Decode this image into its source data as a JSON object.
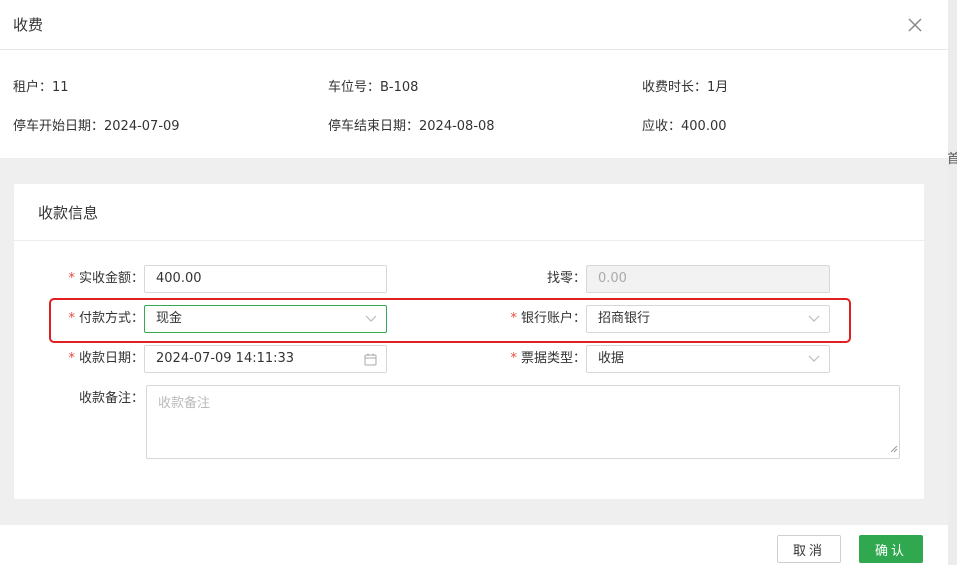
{
  "dialog": {
    "title": "收费",
    "close_icon": "close-icon"
  },
  "summary": {
    "tenant": "租户：11",
    "space": "车位号：B-108",
    "duration": "收费时长：1月",
    "start_date": "停车开始日期：2024-07-09",
    "end_date": "停车结束日期：2024-08-08",
    "receivable": "应收：400.00"
  },
  "payment_section": {
    "title": "收款信息",
    "amount": {
      "label": "实收金额：",
      "value": "400.00"
    },
    "change": {
      "label": "找零：",
      "placeholder": "0.00"
    },
    "method": {
      "label": "付款方式：",
      "value": "现金"
    },
    "bank_account": {
      "label": "银行账户：",
      "value": "招商银行"
    },
    "date": {
      "label": "收款日期：",
      "value": "2024-07-09 14:11:33"
    },
    "receipt_type": {
      "label": "票据类型：",
      "value": "收据"
    },
    "note": {
      "label": "收款备注：",
      "placeholder": "收款备注"
    }
  },
  "footer": {
    "cancel_label": "取消",
    "confirm_label": "确认"
  },
  "colors": {
    "accent": "#2fa84f",
    "required": "#e74c3c",
    "highlight": "#e02020"
  }
}
